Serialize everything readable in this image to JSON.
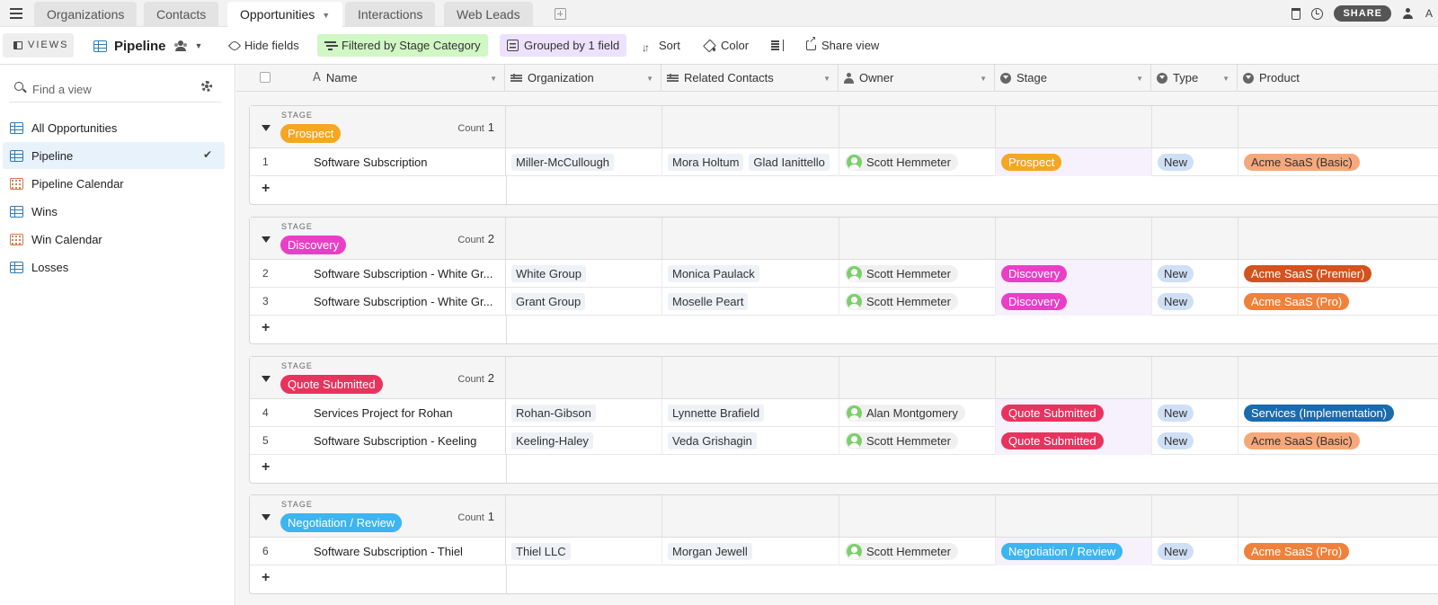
{
  "tabs": [
    {
      "label": "Organizations",
      "active": false
    },
    {
      "label": "Contacts",
      "active": false
    },
    {
      "label": "Opportunities",
      "active": true
    },
    {
      "label": "Interactions",
      "active": false
    },
    {
      "label": "Web Leads",
      "active": false
    }
  ],
  "topright": {
    "share_label": "SHARE",
    "avatar_initial": "A"
  },
  "toolbar": {
    "views_label": "VIEWS",
    "view_name": "Pipeline",
    "hide_fields": "Hide fields",
    "filter": "Filtered by Stage Category",
    "grouped": "Grouped by 1 field",
    "sort": "Sort",
    "color": "Color",
    "share_view": "Share view"
  },
  "sidebar": {
    "search_placeholder": "Find a view",
    "items": [
      {
        "label": "All Opportunities",
        "icon": "grid-icon"
      },
      {
        "label": "Pipeline",
        "icon": "grid-icon",
        "selected": true
      },
      {
        "label": "Pipeline Calendar",
        "icon": "calendar-icon"
      },
      {
        "label": "Wins",
        "icon": "grid-icon"
      },
      {
        "label": "Win Calendar",
        "icon": "calendar-icon"
      },
      {
        "label": "Losses",
        "icon": "grid-icon"
      }
    ]
  },
  "columns": [
    "Name",
    "Organization",
    "Related Contacts",
    "Owner",
    "Stage",
    "Type",
    "Product"
  ],
  "stage_caption": "STAGE",
  "count_label": "Count",
  "colors": {
    "prospect": "#f5a623",
    "discovery": "#e93fc7",
    "quote_submitted": "#e8335f",
    "negotiation": "#3cb5f0",
    "acme_basic": "#f7a87a",
    "acme_premier": "#d4521e",
    "acme_pro": "#f0813a",
    "services": "#1a6aae"
  },
  "groups": [
    {
      "stage": "Prospect",
      "color": "#f5a623",
      "count": "1",
      "rows": [
        {
          "n": "1",
          "name": "Software Subscription",
          "org": "Miller-McCullough",
          "contacts": [
            "Mora Holtum",
            "Glad Ianittello"
          ],
          "owner": "Scott Hemmeter",
          "stage": "Prospect",
          "stage_color": "#f5a623",
          "type": "New",
          "product": "Acme SaaS (Basic)",
          "product_color": "#f7a87a",
          "product_text": "#333"
        }
      ]
    },
    {
      "stage": "Discovery",
      "color": "#e93fc7",
      "count": "2",
      "rows": [
        {
          "n": "2",
          "name": "Software Subscription - White Gr...",
          "org": "White Group",
          "contacts": [
            "Monica Paulack"
          ],
          "owner": "Scott Hemmeter",
          "stage": "Discovery",
          "stage_color": "#e93fc7",
          "type": "New",
          "product": "Acme SaaS (Premier)",
          "product_color": "#d4521e",
          "product_text": "#fff"
        },
        {
          "n": "3",
          "name": "Software Subscription - White Gr...",
          "org": "Grant Group",
          "contacts": [
            "Moselle Peart"
          ],
          "owner": "Scott Hemmeter",
          "stage": "Discovery",
          "stage_color": "#e93fc7",
          "type": "New",
          "product": "Acme SaaS (Pro)",
          "product_color": "#f0813a",
          "product_text": "#fff"
        }
      ]
    },
    {
      "stage": "Quote Submitted",
      "color": "#e8335f",
      "count": "2",
      "rows": [
        {
          "n": "4",
          "name": "Services Project for Rohan",
          "org": "Rohan-Gibson",
          "contacts": [
            "Lynnette Brafield"
          ],
          "owner": "Alan Montgomery",
          "stage": "Quote Submitted",
          "stage_color": "#e8335f",
          "type": "New",
          "product": "Services (Implementation)",
          "product_color": "#1a6aae",
          "product_text": "#fff"
        },
        {
          "n": "5",
          "name": "Software Subscription - Keeling",
          "org": "Keeling-Haley",
          "contacts": [
            "Veda Grishagin"
          ],
          "owner": "Scott Hemmeter",
          "stage": "Quote Submitted",
          "stage_color": "#e8335f",
          "type": "New",
          "product": "Acme SaaS (Basic)",
          "product_color": "#f7a87a",
          "product_text": "#333"
        }
      ]
    },
    {
      "stage": "Negotiation / Review",
      "color": "#3cb5f0",
      "count": "1",
      "rows": [
        {
          "n": "6",
          "name": "Software Subscription - Thiel",
          "org": "Thiel LLC",
          "contacts": [
            "Morgan Jewell"
          ],
          "owner": "Scott Hemmeter",
          "stage": "Negotiation / Review",
          "stage_color": "#3cb5f0",
          "type": "New",
          "product": "Acme SaaS (Pro)",
          "product_color": "#f0813a",
          "product_text": "#fff"
        }
      ]
    }
  ]
}
